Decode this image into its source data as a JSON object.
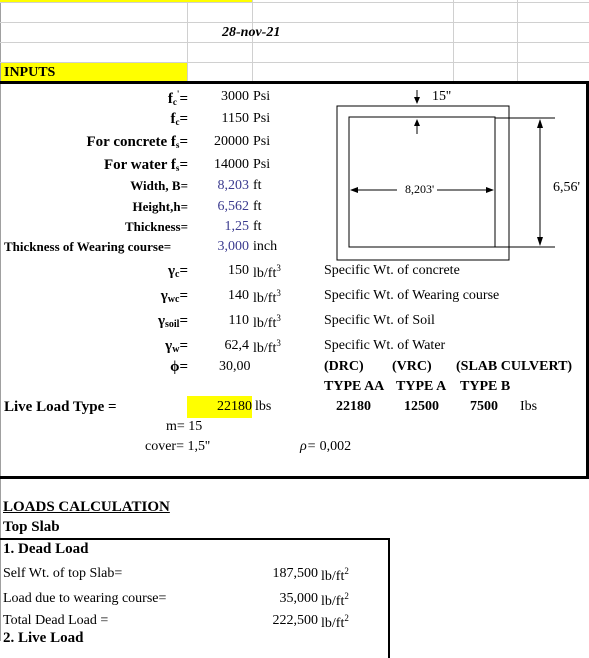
{
  "header": {
    "date": "28-nov-21",
    "inputs_title": "INPUTS"
  },
  "inputs": [
    {
      "label_main": "f",
      "label_sub": "c",
      "label_sup": "'",
      "eq": "=",
      "value": "3000",
      "unit": "Psi",
      "highlight": false
    },
    {
      "label_main": "f",
      "label_sub": "c",
      "label_sup": "",
      "eq": "=",
      "value": "1150",
      "unit": "Psi",
      "highlight": false
    },
    {
      "label_main": "For concrete f",
      "label_sub": "s",
      "label_sup": "",
      "eq": "=",
      "value": "20000",
      "unit": "Psi",
      "highlight": false
    },
    {
      "label_main": "For water f",
      "label_sub": "s",
      "label_sup": "",
      "eq": "=",
      "value": "14000",
      "unit": "Psi",
      "highlight": false
    },
    {
      "label_main": "Width, B=",
      "label_sub": "",
      "label_sup": "",
      "eq": "",
      "value": "8,203",
      "unit": "ft",
      "highlight": true
    },
    {
      "label_main": "Height,h=",
      "label_sub": "",
      "label_sup": "",
      "eq": "",
      "value": "6,562",
      "unit": "ft",
      "highlight": true
    },
    {
      "label_main": "Thickness=",
      "label_sub": "",
      "label_sup": "",
      "eq": "",
      "value": "1,25",
      "unit": "ft",
      "highlight": true
    },
    {
      "label_main": "Thickness of Wearing course=",
      "label_sub": "",
      "label_sup": "",
      "eq": "",
      "value": "3,000",
      "unit": "inch",
      "highlight": true
    }
  ],
  "unit_weights": [
    {
      "symbol": "γ",
      "sub": "c",
      "value": "150",
      "unit": "lb/ft",
      "unit_sup": "3",
      "description": "Specific Wt. of concrete"
    },
    {
      "symbol": "γ",
      "sub": "wc",
      "value": "140",
      "unit": "lb/ft",
      "unit_sup": "3",
      "description": "Specific Wt. of Wearing course"
    },
    {
      "symbol": "γ",
      "sub": "soil",
      "value": "110",
      "unit": "lb/ft",
      "unit_sup": "3",
      "description": "Specific Wt. of Soil"
    },
    {
      "symbol": "γ",
      "sub": "w",
      "value": "62,4",
      "unit": "lb/ft",
      "unit_sup": "3",
      "description": "Specific Wt. of Water"
    }
  ],
  "phi": {
    "symbol": "ϕ",
    "eq": "=",
    "value": "30,00"
  },
  "diagram": {
    "thickness_label": "15''",
    "width_label": "8,203'",
    "height_label": "6,56'"
  },
  "live_load_types": {
    "headers1": [
      "(DRC)",
      "(VRC)",
      "(SLAB CULVERT)"
    ],
    "headers2": [
      "TYPE AA",
      "TYPE A",
      "TYPE B"
    ],
    "values": [
      "22180",
      "12500",
      "7500"
    ],
    "unit": "Ibs"
  },
  "live_load": {
    "label": "Live Load Type =",
    "value": "22180",
    "unit": "lbs"
  },
  "m": {
    "label": "m=",
    "value": "15"
  },
  "cover": {
    "label": "cover=",
    "value": "1,5''"
  },
  "rho": {
    "label": "ρ=",
    "value": "0,002"
  },
  "loads": {
    "title": "LOADS CALCULATION",
    "subtitle": "Top Slab",
    "dead_load_title": "1. Dead Load",
    "rows": [
      {
        "label": "Self Wt. of top Slab=",
        "value": "187,500",
        "unit": "lb/ft",
        "unit_sup": "2"
      },
      {
        "label": "Load due to wearing course=",
        "value": "35,000",
        "unit": "lb/ft",
        "unit_sup": "2"
      },
      {
        "label": "Total Dead Load =",
        "value": "222,500",
        "unit": "lb/ft",
        "unit_sup": "2"
      }
    ],
    "live_load_title": "2. Live Load"
  },
  "colors": {
    "highlight": "#ffff00",
    "input_blue": "#3b3b8f"
  }
}
